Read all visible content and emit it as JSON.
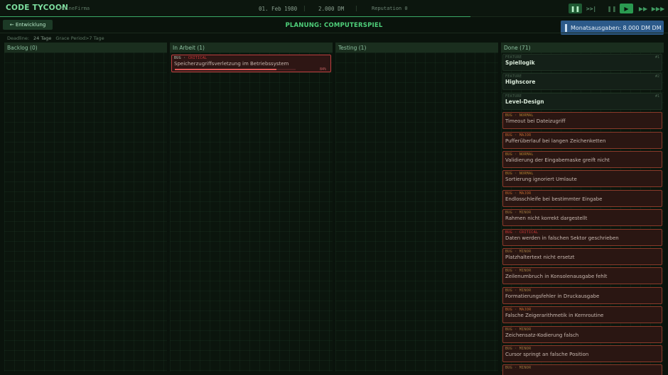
{
  "topbar": {
    "brand": "CODE TYCOON",
    "company": "MeineFirma",
    "date": "01. Feb 1980",
    "separator": "|",
    "money": "2.000 DM",
    "reputation": "Reputation 0",
    "controls": {
      "pause": "❚❚",
      "step": ">>|",
      "pause_alt": "❚❚",
      "play": "▶",
      "fast": "▶▶",
      "fastest": "▶▶▶"
    }
  },
  "header": {
    "back_label": "← Entwicklung",
    "title": "PLANUNG: COMPUTERSPIEL",
    "monthly_expenses": "Monatsausgaben: 8.000 DM DM"
  },
  "deadline": {
    "label": "Deadline:",
    "value": "24 Tage",
    "grace": "Grace Period>7 Tage"
  },
  "columns": {
    "backlog": "Backlog (0)",
    "in_progress": "In Arbeit (1)",
    "testing": "Testing (1)",
    "done": "Done (71)"
  },
  "in_progress_cards": [
    {
      "type": "BUG",
      "severity": "CRITICAL",
      "title": "Speicherzugriffsverletzung im Betriebssystem",
      "progress": 0.84,
      "progress_label": "84%"
    }
  ],
  "done_features": [
    {
      "type": "FEATURE",
      "title": "Spiellogik",
      "num": "#1"
    },
    {
      "type": "FEATURE",
      "title": "Highscore",
      "num": "#2"
    },
    {
      "type": "FEATURE",
      "title": "Level-Design",
      "num": "#1"
    }
  ],
  "done_bugs": [
    {
      "type": "BUG",
      "severity": "NORMAL",
      "title": "Timeout bei Dateizugriff"
    },
    {
      "type": "BUG",
      "severity": "MAJOR",
      "title": "Pufferüberlauf bei langen Zeichenketten"
    },
    {
      "type": "BUG",
      "severity": "NORMAL",
      "title": "Validierung der Eingabemaske greift nicht"
    },
    {
      "type": "BUG",
      "severity": "NORMAL",
      "title": "Sortierung ignoriert Umlaute"
    },
    {
      "type": "BUG",
      "severity": "MAJOR",
      "title": "Endlosschleife bei bestimmter Eingabe"
    },
    {
      "type": "BUG",
      "severity": "MINOR",
      "title": "Rahmen nicht korrekt dargestellt"
    },
    {
      "type": "BUG",
      "severity": "CRITICAL",
      "title": "Daten werden in falschen Sektor geschrieben"
    },
    {
      "type": "BUG",
      "severity": "MINOR",
      "title": "Platzhaltertext nicht ersetzt"
    },
    {
      "type": "BUG",
      "severity": "MINOR",
      "title": "Zeilenumbruch in Konsolenausgabe fehlt"
    },
    {
      "type": "BUG",
      "severity": "MINOR",
      "title": "Formatierungsfehler in Druckausgabe"
    },
    {
      "type": "BUG",
      "severity": "MAJOR",
      "title": "Falsche Zeigerarithmetik in Kernroutine"
    },
    {
      "type": "BUG",
      "severity": "MINOR",
      "title": "Zeichensatz-Kodierung falsch"
    },
    {
      "type": "BUG",
      "severity": "MINOR",
      "title": "Cursor springt an falsche Position"
    },
    {
      "type": "BUG",
      "severity": "MINOR",
      "title": ""
    }
  ]
}
